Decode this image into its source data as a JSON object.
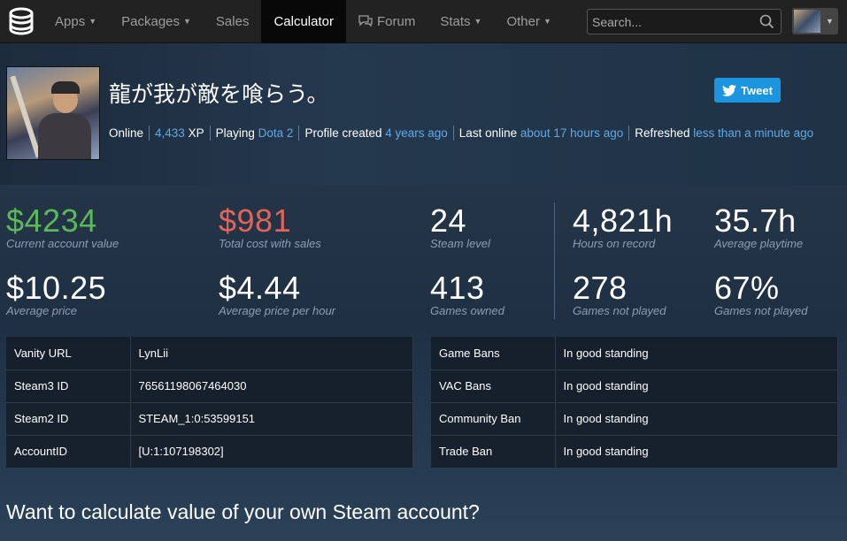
{
  "nav": {
    "items": [
      {
        "label": "Apps",
        "caret": true,
        "active": false
      },
      {
        "label": "Packages",
        "caret": true,
        "active": false
      },
      {
        "label": "Sales",
        "caret": false,
        "active": false
      },
      {
        "label": "Calculator",
        "caret": false,
        "active": true
      },
      {
        "label": "Forum",
        "caret": false,
        "active": false,
        "icon": "forum-icon"
      },
      {
        "label": "Stats",
        "caret": true,
        "active": false
      },
      {
        "label": "Other",
        "caret": true,
        "active": false
      }
    ],
    "search_placeholder": "Search..."
  },
  "profile": {
    "name": "龍が我が敵を喰らう。",
    "tweet_label": "Tweet",
    "status": "Online",
    "xp_value": "4,433",
    "xp_unit": "XP",
    "playing_label": "Playing",
    "playing_game": "Dota 2",
    "created_label": "Profile created",
    "created_value": "4 years ago",
    "last_online_label": "Last online",
    "last_online_value": "about 17 hours ago",
    "refreshed_label": "Refreshed",
    "refreshed_value": "less than a minute ago"
  },
  "stats": {
    "account_value": {
      "value": "$4234",
      "label": "Current account value"
    },
    "total_cost": {
      "value": "$981",
      "label": "Total cost with sales"
    },
    "steam_level": {
      "value": "24",
      "label": "Steam level"
    },
    "hours_on_record": {
      "value": "4,821h",
      "label": "Hours on record"
    },
    "average_playtime": {
      "value": "35.7h",
      "label": "Average playtime"
    },
    "average_price": {
      "value": "$10.25",
      "label": "Average price"
    },
    "price_per_hour": {
      "value": "$4.44",
      "label": "Average price per hour"
    },
    "games_owned": {
      "value": "413",
      "label": "Games owned"
    },
    "games_not_played": {
      "value": "278",
      "label": "Games not played"
    },
    "pct_not_played": {
      "value": "67%",
      "label": "Games not played"
    }
  },
  "ids_table": [
    {
      "key": "Vanity URL",
      "value": "LynLii"
    },
    {
      "key": "Steam3 ID",
      "value": "76561198067464030"
    },
    {
      "key": "Steam2 ID",
      "value": "STEAM_1:0:53599151"
    },
    {
      "key": "AccountID",
      "value": "[U:1:107198302]"
    }
  ],
  "bans_table": [
    {
      "key": "Game Bans",
      "value": "In good standing"
    },
    {
      "key": "VAC Bans",
      "value": "In good standing"
    },
    {
      "key": "Community Ban",
      "value": "In good standing"
    },
    {
      "key": "Trade Ban",
      "value": "In good standing"
    }
  ],
  "calc_heading": "Want to calculate value of your own Steam account?",
  "colors": {
    "accent_blue": "#62a8e4",
    "value_green": "#5cb85c",
    "value_red": "#e0645a",
    "tweet_blue": "#1b95e0"
  }
}
